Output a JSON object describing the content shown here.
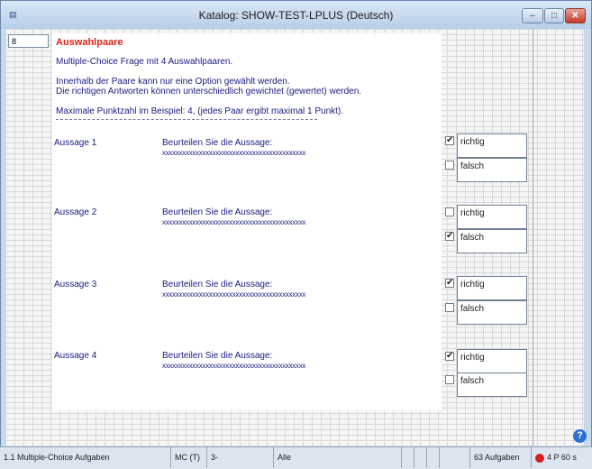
{
  "window": {
    "title": "Katalog: SHOW-TEST-LPLUS (Deutsch)",
    "minimize_glyph": "–",
    "maximize_glyph": "□",
    "close_glyph": "✕"
  },
  "item_number": "8",
  "content": {
    "heading": "Auswahlpaare",
    "intro": "Multiple-Choice Frage mit 4 Auswahlpaaren.",
    "line2": "Innerhalb der Paare kann nur eine Option gewählt werden.",
    "line3": "Die richtigen Antworten können unterschiedlich gewichtet (gewertet) werden.",
    "line4": "Maximale Punktzahl im Beispiel: 4, (jedes Paar ergibt maximal 1 Punkt).",
    "statements": [
      {
        "label": "Aussage 1",
        "prompt": "Beurteilen Sie die Aussage:",
        "filler": "xxxxxxxxxxxxxxxxxxxxxxxxxxxxxxxxxxxxxxxxxxx",
        "options": [
          {
            "label": "richtig",
            "checked": true
          },
          {
            "label": "falsch",
            "checked": false
          }
        ]
      },
      {
        "label": "Aussage 2",
        "prompt": "Beurteilen Sie die Aussage:",
        "filler": "xxxxxxxxxxxxxxxxxxxxxxxxxxxxxxxxxxxxxxxxxxx",
        "options": [
          {
            "label": "richtig",
            "checked": false
          },
          {
            "label": "falsch",
            "checked": true
          }
        ]
      },
      {
        "label": "Aussage 3",
        "prompt": "Beurteilen Sie die Aussage:",
        "filler": "xxxxxxxxxxxxxxxxxxxxxxxxxxxxxxxxxxxxxxxxxxx",
        "options": [
          {
            "label": "richtig",
            "checked": true
          },
          {
            "label": "falsch",
            "checked": false
          }
        ]
      },
      {
        "label": "Aussage 4",
        "prompt": "Beurteilen Sie die Aussage:",
        "filler": "xxxxxxxxxxxxxxxxxxxxxxxxxxxxxxxxxxxxxxxxxxx",
        "options": [
          {
            "label": "richtig",
            "checked": true
          },
          {
            "label": "falsch",
            "checked": false
          }
        ]
      }
    ]
  },
  "statusbar": {
    "section": "1.1 Multiple-Choice Aufgaben",
    "type": "MC (T)",
    "count": "3-",
    "filter": "Alle",
    "total": "63 Aufgaben",
    "points": "4 P 60 s"
  },
  "help_glyph": "?",
  "checkmark": "✔"
}
